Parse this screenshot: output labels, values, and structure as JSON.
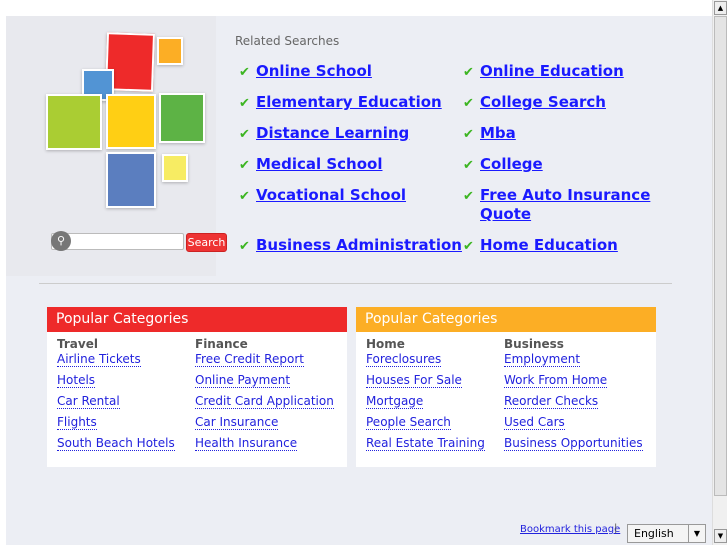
{
  "related": {
    "title": "Related Searches",
    "links": [
      "Online School",
      "Online Education",
      "Elementary Education",
      "College Search",
      "Distance Learning",
      "Mba",
      "Medical School",
      "College",
      "Vocational School",
      "Free Auto Insurance Quote",
      "Business Administration",
      "Home Education"
    ]
  },
  "search": {
    "button": "Search",
    "placeholder": ""
  },
  "panels": [
    {
      "title": "Popular Categories",
      "color": "#ee2a2a",
      "cols": [
        {
          "title": "Travel",
          "items": [
            "Airline Tickets",
            "Hotels",
            "Car Rental",
            "Flights",
            "South Beach Hotels"
          ]
        },
        {
          "title": "Finance",
          "items": [
            "Free Credit Report",
            "Online Payment",
            "Credit Card Application",
            "Car Insurance",
            "Health Insurance"
          ]
        }
      ]
    },
    {
      "title": "Popular Categories",
      "color": "#fcae25",
      "cols": [
        {
          "title": "Home",
          "items": [
            "Foreclosures",
            "Houses For Sale",
            "Mortgage",
            "People Search",
            "Real Estate Training"
          ]
        },
        {
          "title": "Business",
          "items": [
            "Employment",
            "Work From Home",
            "Reorder Checks",
            "Used Cars",
            "Business Opportunities"
          ]
        }
      ]
    }
  ],
  "footer": {
    "bookmark": "Bookmark this page",
    "separator": "|",
    "language": "English"
  }
}
